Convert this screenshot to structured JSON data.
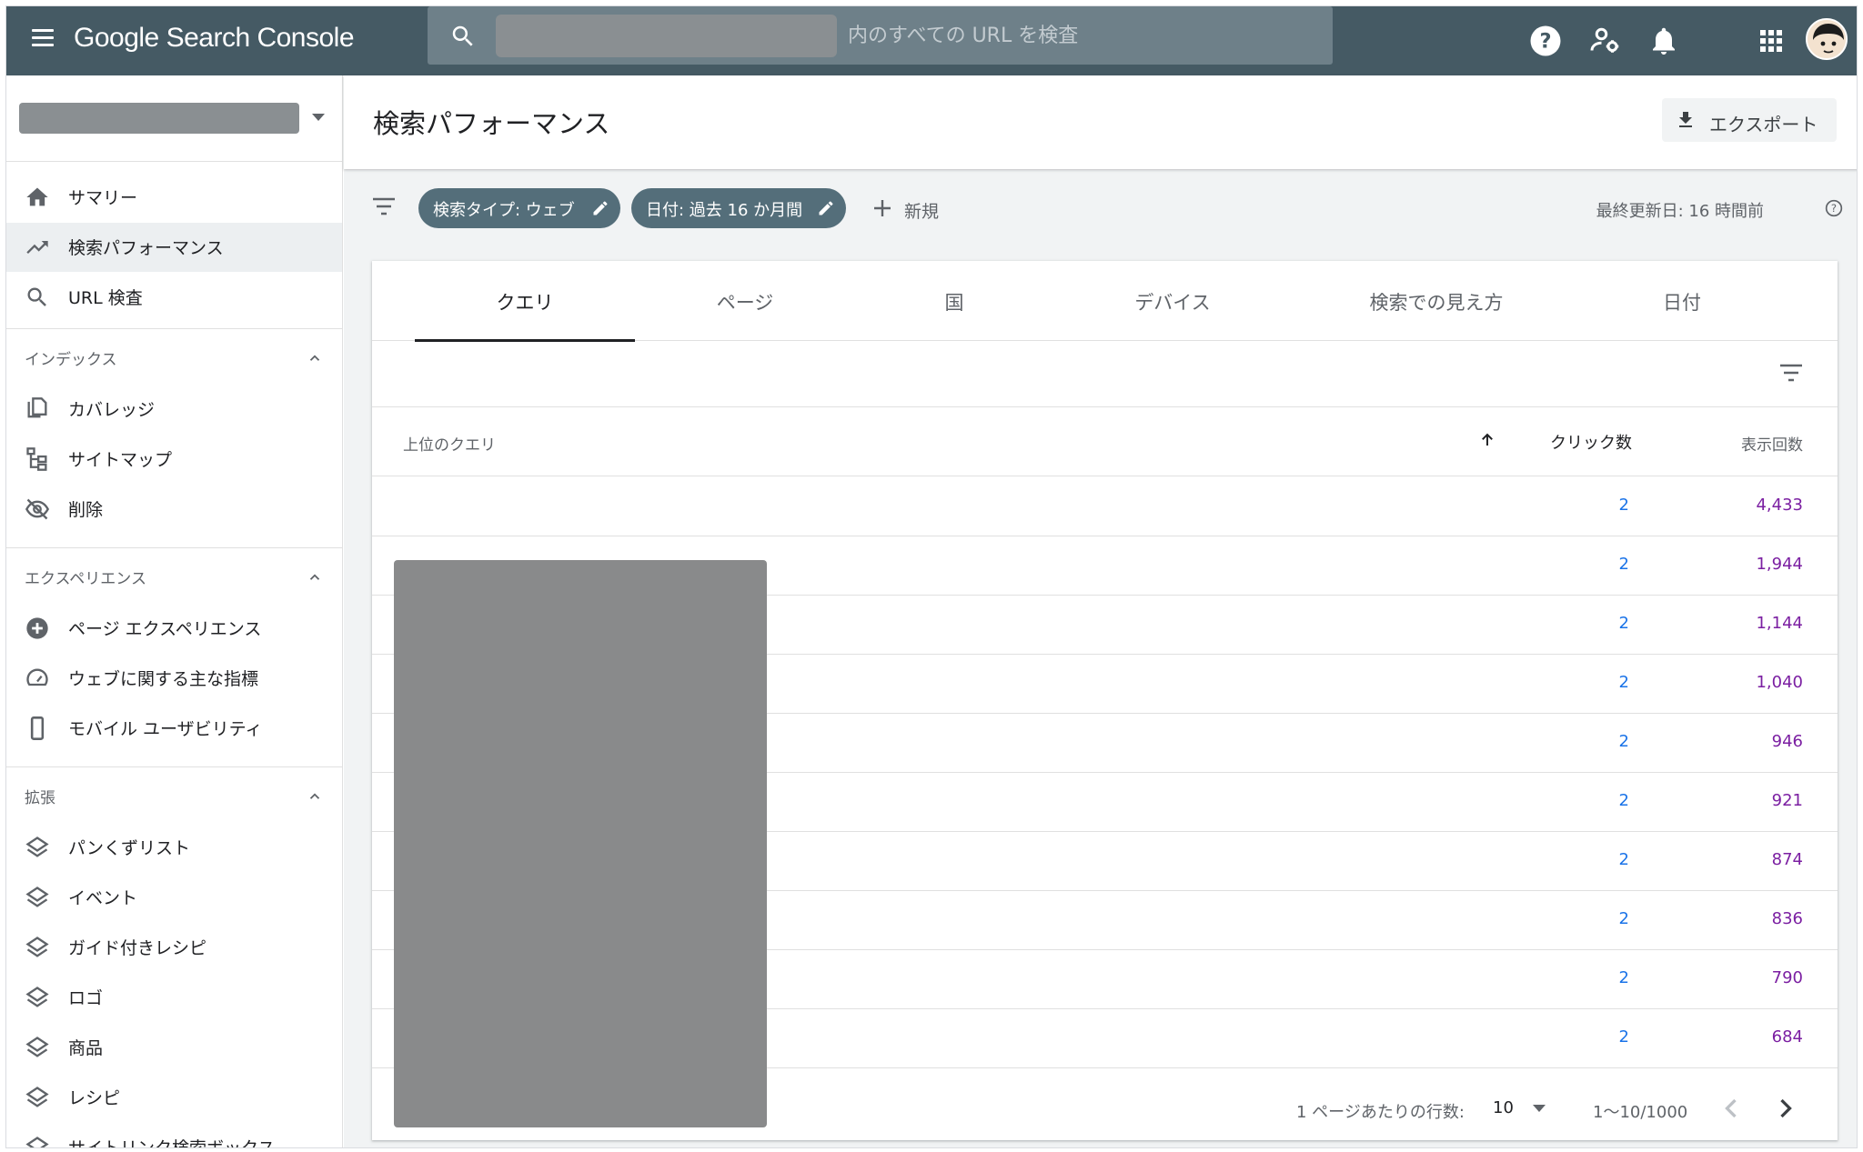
{
  "app": {
    "brand": "Google Search Console"
  },
  "search": {
    "placeholder": "内のすべての URL を検査"
  },
  "topbar_icons": [
    "help-icon",
    "user-settings-icon",
    "notifications-icon",
    "apps-grid-icon",
    "account-avatar"
  ],
  "sidebar": {
    "main_items": [
      {
        "label": "サマリー",
        "icon": "home-icon"
      },
      {
        "label": "検索パフォーマンス",
        "icon": "trending-up-icon",
        "active": true
      },
      {
        "label": "URL 検査",
        "icon": "search-icon"
      }
    ],
    "sections": [
      {
        "title": "インデックス",
        "items": [
          {
            "label": "カバレッジ",
            "icon": "copy-pages-icon"
          },
          {
            "label": "サイトマップ",
            "icon": "sitemap-icon"
          },
          {
            "label": "削除",
            "icon": "visibility-off-icon"
          }
        ]
      },
      {
        "title": "エクスペリエンス",
        "items": [
          {
            "label": "ページ エクスペリエンス",
            "icon": "add-circle-icon"
          },
          {
            "label": "ウェブに関する主な指標",
            "icon": "speed-gauge-icon"
          },
          {
            "label": "モバイル ユーザビリティ",
            "icon": "smartphone-icon"
          }
        ]
      },
      {
        "title": "拡張",
        "items": [
          {
            "label": "パンくずリスト",
            "icon": "layers-icon"
          },
          {
            "label": "イベント",
            "icon": "layers-icon"
          },
          {
            "label": "ガイド付きレシピ",
            "icon": "layers-icon"
          },
          {
            "label": "ロゴ",
            "icon": "layers-icon"
          },
          {
            "label": "商品",
            "icon": "layers-icon"
          },
          {
            "label": "レシピ",
            "icon": "layers-icon"
          },
          {
            "label": "サイトリンク検索ボックス",
            "icon": "layers-icon"
          }
        ]
      }
    ]
  },
  "header": {
    "title": "検索パフォーマンス",
    "export_label": "エクスポート"
  },
  "filters": {
    "chips": [
      "検索タイプ: ウェブ",
      "日付: 過去 16 か月間"
    ],
    "new_label": "新規",
    "last_updated": "最終更新日: 16 時間前"
  },
  "tabs": [
    "クエリ",
    "ページ",
    "国",
    "デバイス",
    "検索での見え方",
    "日付"
  ],
  "active_tab": "クエリ",
  "table": {
    "col_query": "上位のクエリ",
    "col_clicks": "クリック数",
    "col_impressions": "表示回数",
    "sort": {
      "column": "クリック数",
      "direction": "ascending"
    },
    "rows": [
      {
        "clicks": "2",
        "impressions": "4,433"
      },
      {
        "clicks": "2",
        "impressions": "1,944"
      },
      {
        "clicks": "2",
        "impressions": "1,144"
      },
      {
        "clicks": "2",
        "impressions": "1,040"
      },
      {
        "clicks": "2",
        "impressions": "946"
      },
      {
        "clicks": "2",
        "impressions": "921"
      },
      {
        "clicks": "2",
        "impressions": "874"
      },
      {
        "clicks": "2",
        "impressions": "836"
      },
      {
        "clicks": "2",
        "impressions": "790"
      },
      {
        "clicks": "2",
        "impressions": "684"
      }
    ]
  },
  "pagination": {
    "rows_per_page_label": "1 ページあたりの行数:",
    "rows_per_page": "10",
    "range": "1〜10/1000"
  },
  "colors": {
    "topbar": "#455a64",
    "chip": "#546e7a",
    "clicks": "#1a73e8",
    "impressions": "#7b1fa2"
  }
}
